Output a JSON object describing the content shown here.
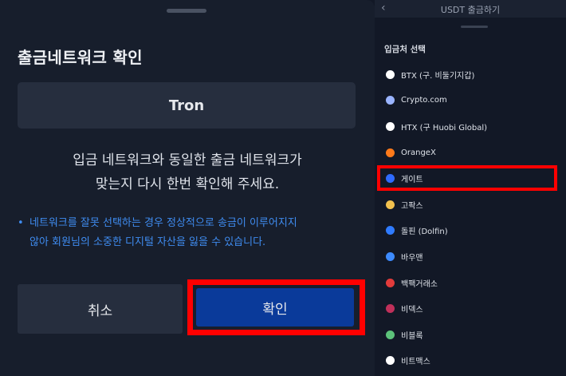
{
  "modal": {
    "title": "출금네트워크 확인",
    "network": "Tron",
    "message_line1": "입금 네트워크와 동일한 출금 네트워크가",
    "message_line2": "맞는지 다시 한번 확인해 주세요.",
    "warning_bullet": "•",
    "warning_line1": "네트워크를 잘못 선택하는 경우 정상적으로 송금이 이루어지지",
    "warning_line2": "않아 회원님의 소중한 디지털 자산을 잃을 수 있습니다.",
    "cancel_label": "취소",
    "confirm_label": "확인"
  },
  "right_panel": {
    "back_icon": "‹",
    "title": "USDT 출금하기",
    "section_title": "입금처 선택",
    "exchanges": [
      {
        "name": "BTX (구. 비둘기지갑)",
        "icon": "btx-icon",
        "color": "#ffffff"
      },
      {
        "name": "Crypto.com",
        "icon": "crypto-com-icon",
        "color": "#9ab4ff"
      },
      {
        "name": "HTX (구 Huobi Global)",
        "icon": "htx-icon",
        "color": "#ffffff"
      },
      {
        "name": "OrangeX",
        "icon": "orangex-icon",
        "color": "#ff7a1a"
      },
      {
        "name": "게이트",
        "icon": "gate-icon",
        "color": "#2f6bff"
      },
      {
        "name": "고팍스",
        "icon": "gopax-icon",
        "color": "#f2c14e"
      },
      {
        "name": "돌핀 (Dolfin)",
        "icon": "dolfin-icon",
        "color": "#2f7bff"
      },
      {
        "name": "바우맨",
        "icon": "bauman-icon",
        "color": "#3d8bff"
      },
      {
        "name": "백팩거래소",
        "icon": "backpack-icon",
        "color": "#e23b3b"
      },
      {
        "name": "비덱스",
        "icon": "bidex-icon",
        "color": "#c0305a"
      },
      {
        "name": "비블록",
        "icon": "biblock-icon",
        "color": "#5cc27a"
      },
      {
        "name": "비트맥스",
        "icon": "bitmax-icon",
        "color": "#ffffff"
      }
    ]
  }
}
